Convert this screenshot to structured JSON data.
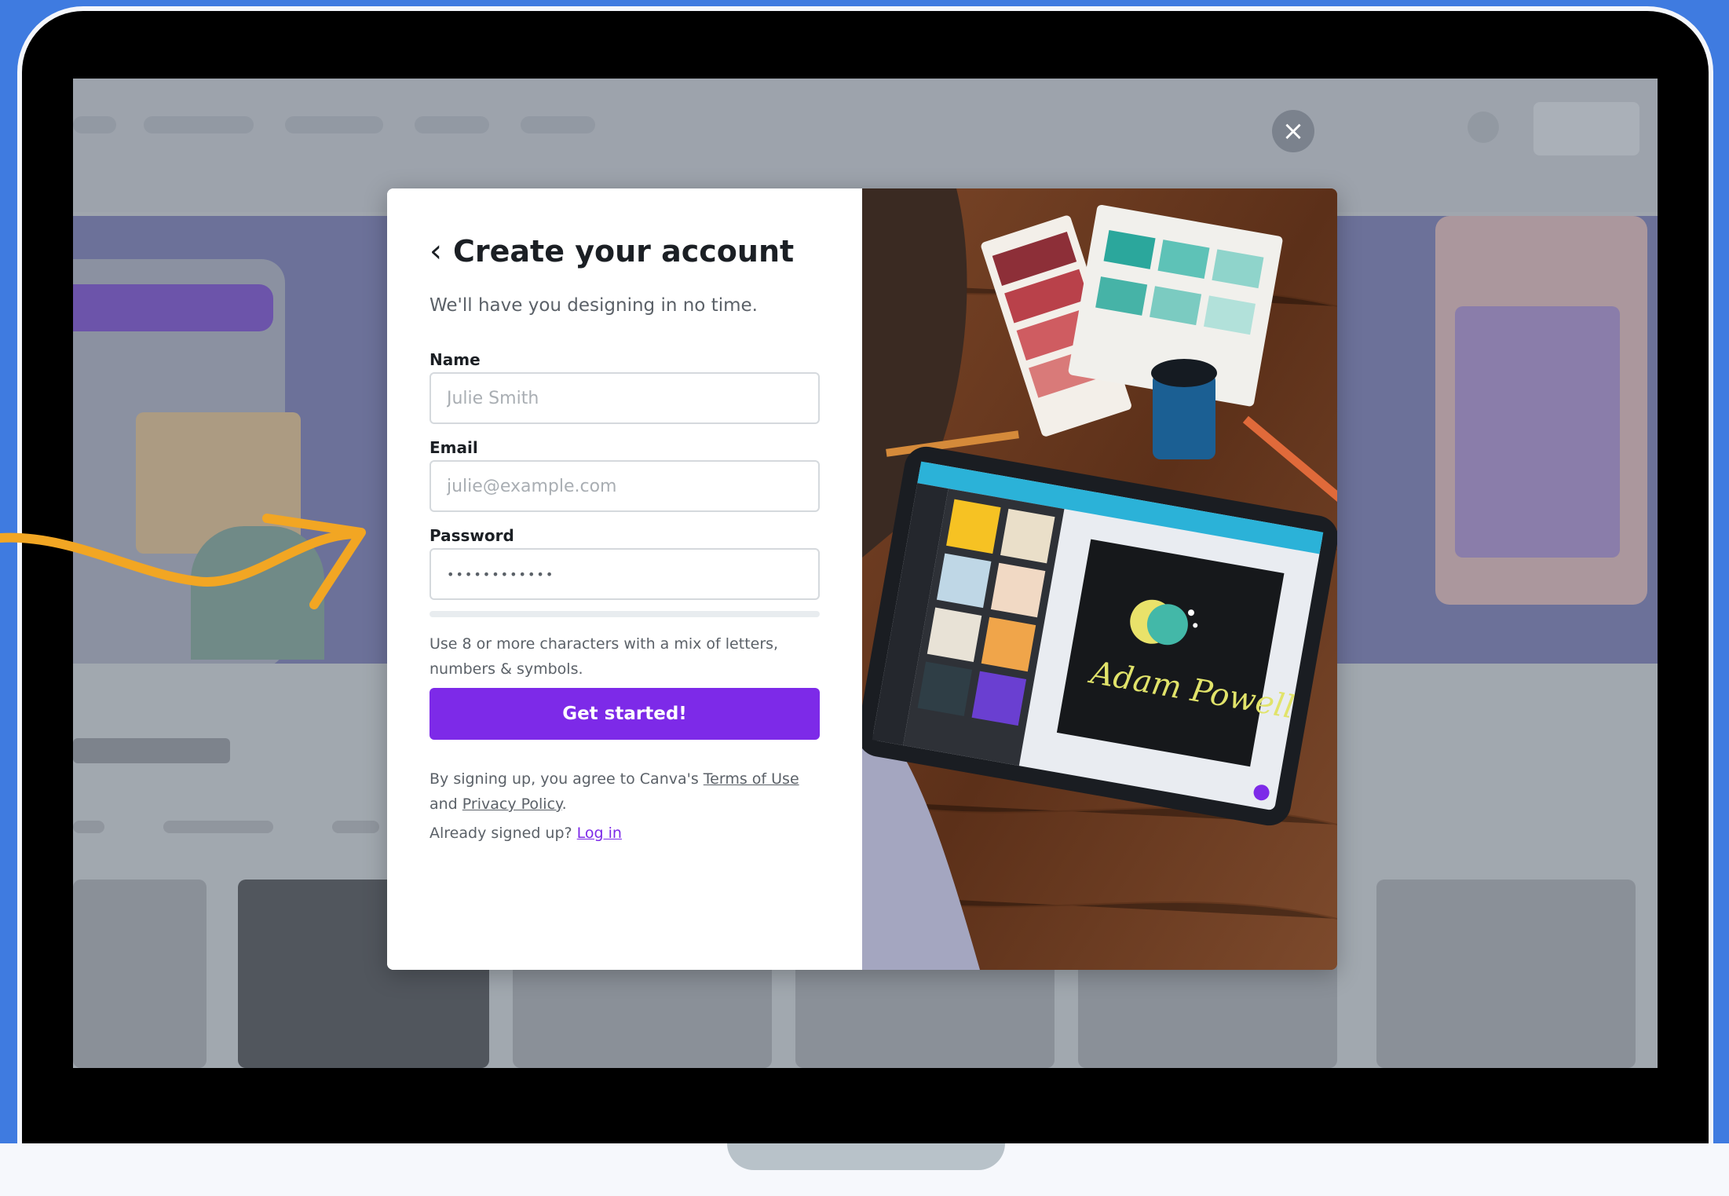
{
  "modal": {
    "title": "Create your account",
    "subtitle": "We'll have you designing in no time.",
    "name_label": "Name",
    "name_placeholder": "Julie Smith",
    "email_label": "Email",
    "email_placeholder": "julie@example.com",
    "password_label": "Password",
    "password_value": "••••••••••••",
    "hint": "Use 8 or more characters with a mix of letters, numbers & symbols.",
    "cta_label": "Get started!",
    "legal_prefix": "By signing up, you agree to Canva's",
    "terms_label": "Terms of Use",
    "legal_and": "and",
    "privacy_label": "Privacy Policy",
    "legal_suffix": ".",
    "already_text": "Already signed up?",
    "login_label": "Log in",
    "close_icon": "close-icon",
    "back_icon": "chevron-left-icon"
  },
  "photo": {
    "tablet_logo_text": "Adam Powell"
  },
  "colors": {
    "accent": "#7d2ae8",
    "frame_bg": "#3f7be0",
    "arrow": "#f2a623"
  }
}
